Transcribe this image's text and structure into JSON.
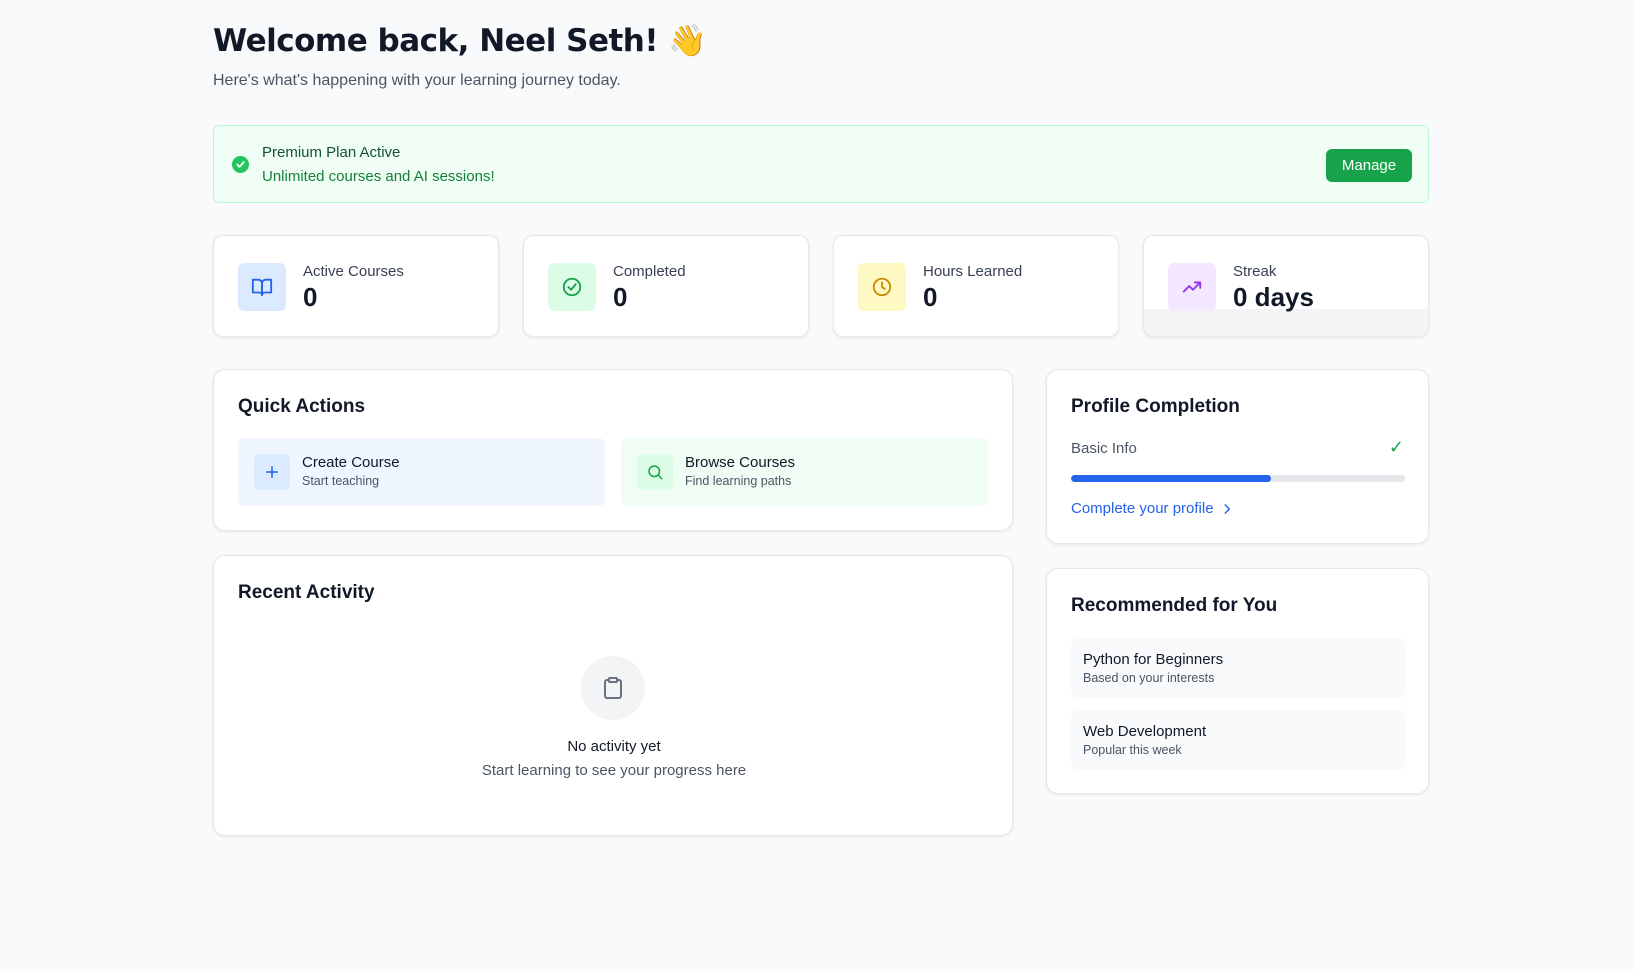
{
  "header": {
    "title": "Welcome back, Neel Seth! 👋",
    "subtitle": "Here's what's happening with your learning journey today."
  },
  "plan_banner": {
    "title": "Premium Plan Active",
    "subtitle": "Unlimited courses and AI sessions!",
    "manage_label": "Manage",
    "icon": "check-circle-icon"
  },
  "stats": [
    {
      "label": "Active Courses",
      "value": "0",
      "icon": "book-open-icon",
      "color": "#2563eb",
      "bg": "#dbeafe"
    },
    {
      "label": "Completed",
      "value": "0",
      "icon": "check-circle-icon",
      "color": "#16a34a",
      "bg": "#dcfce7"
    },
    {
      "label": "Hours Learned",
      "value": "0",
      "icon": "clock-icon",
      "color": "#ca8a04",
      "bg": "#fef9c3"
    },
    {
      "label": "Streak",
      "value": "0 days",
      "icon": "trending-up-icon",
      "color": "#9333ea",
      "bg": "#f3e8ff"
    }
  ],
  "quick_actions": {
    "title": "Quick Actions",
    "items": [
      {
        "title": "Create Course",
        "subtitle": "Start teaching",
        "icon": "plus-icon",
        "bg": "#eff6ff",
        "icon_bg": "#dbeafe",
        "color": "#2563eb"
      },
      {
        "title": "Browse Courses",
        "subtitle": "Find learning paths",
        "icon": "search-icon",
        "bg": "#f0fdf4",
        "icon_bg": "#dcfce7",
        "color": "#16a34a"
      }
    ]
  },
  "recent_activity": {
    "title": "Recent Activity",
    "empty_title": "No activity yet",
    "empty_subtitle": "Start learning to see your progress here",
    "icon": "clipboard-icon"
  },
  "profile_completion": {
    "title": "Profile Completion",
    "item_label": "Basic Info",
    "check": "✓",
    "progress": 0.6,
    "link_label": "Complete your profile"
  },
  "recommended": {
    "title": "Recommended for You",
    "items": [
      {
        "title": "Python for Beginners",
        "subtitle": "Based on your interests"
      },
      {
        "title": "Web Development",
        "subtitle": "Popular this week"
      }
    ]
  }
}
